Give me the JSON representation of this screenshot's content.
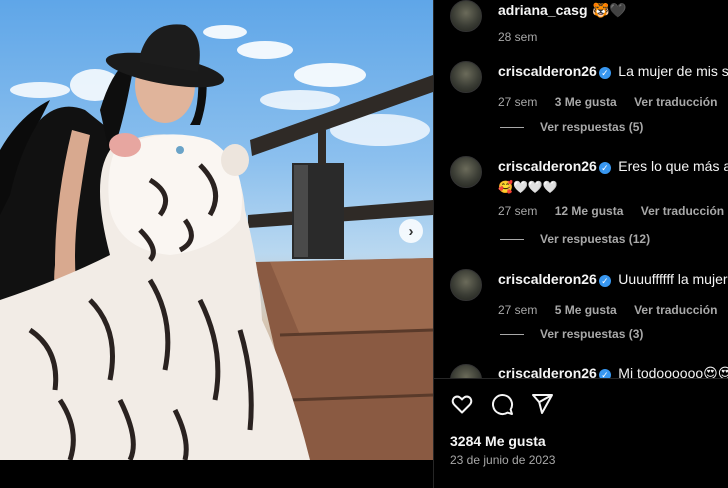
{
  "post": {
    "author": "adriana_casg",
    "author_emoji": "🐯🖤",
    "age": "28 sem",
    "likes": "3284 Me gusta",
    "date": "23 de junio de 2023"
  },
  "comments": [
    {
      "username": "criscalderon26",
      "text": "La mujer de mis sueños",
      "age": "27 sem",
      "likes": "3 Me gusta",
      "translate": "Ver traducción",
      "replies": "Ver respuestas (5)"
    },
    {
      "username": "criscalderon26",
      "text": "Eres lo que más amo",
      "emojis": "🥰🤍🤍🤍",
      "age": "27 sem",
      "likes": "12 Me gusta",
      "translate": "Ver traducción",
      "replies": "Ver respuestas (12)"
    },
    {
      "username": "criscalderon26",
      "text": "Uuuuffffff la mujer de mi vida",
      "age": "27 sem",
      "likes": "5 Me gusta",
      "translate": "Ver traducción",
      "replies": "Ver respuestas (3)"
    },
    {
      "username": "criscalderon26",
      "text": "Mi todoooooo😍😍"
    }
  ],
  "icons": {
    "like": "heart-icon",
    "comment": "comment-icon",
    "share": "share-icon",
    "next": "chevron-right-icon",
    "verified": "verified-badge-icon"
  },
  "colors": {
    "background": "#000000",
    "text_primary": "#f5f5f5",
    "text_secondary": "#a8a8a8",
    "verified": "#3897f0"
  }
}
